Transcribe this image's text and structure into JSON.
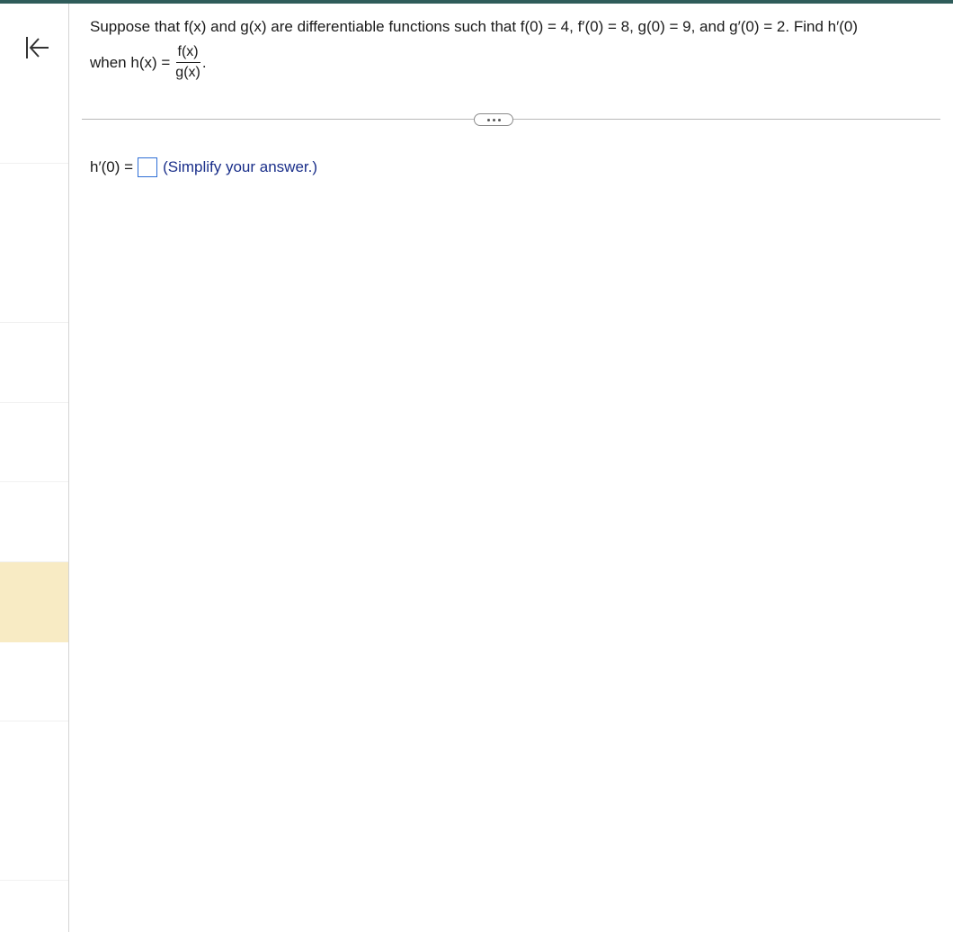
{
  "question": {
    "line1": "Suppose that f(x) and g(x) are differentiable functions such that f(0) = 4, f′(0) = 8, g(0) = 9, and g′(0) = 2. Find h′(0)",
    "line2_prefix": "when h(x) =",
    "fraction_numerator": "f(x)",
    "fraction_denominator": "g(x)",
    "line2_suffix": "."
  },
  "answer": {
    "label": "h′(0) =",
    "value": "",
    "hint": "(Simplify your answer.)"
  },
  "sidebar": {
    "collapse_icon": "collapse-left-icon"
  },
  "toolbar": {
    "more_icon": "ellipsis-icon"
  },
  "colors": {
    "top_bar": "#2f5c5a",
    "active_item": "#f8ebc4",
    "answer_border": "#2f6fd6",
    "hint_text": "#1a2f8a"
  }
}
